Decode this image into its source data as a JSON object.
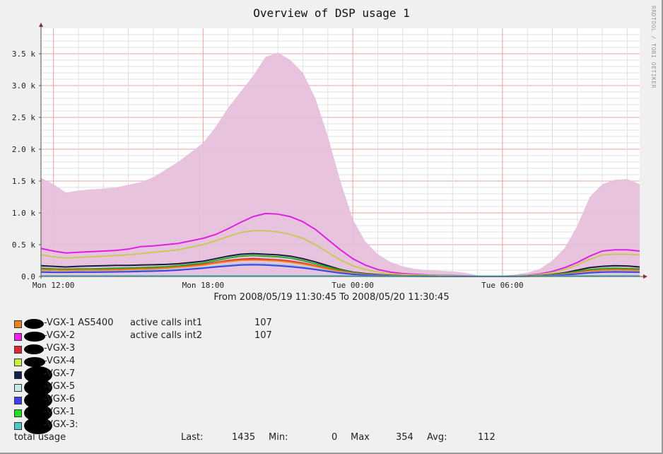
{
  "chart_data": {
    "type": "area",
    "title": "Overview of DSP usage 1",
    "watermark": "RRDTOOL / TOBI OETIKER",
    "xlabel": "",
    "ylabel": "",
    "ylim": [
      0,
      3900
    ],
    "y_ticks": [
      {
        "value": 0,
        "label": "0.0"
      },
      {
        "value": 500,
        "label": "0.5 k"
      },
      {
        "value": 1000,
        "label": "1.0 k"
      },
      {
        "value": 1500,
        "label": "1.5 k"
      },
      {
        "value": 2000,
        "label": "2.0 k"
      },
      {
        "value": 2500,
        "label": "2.5 k"
      },
      {
        "value": 3000,
        "label": "3.0 k"
      },
      {
        "value": 3500,
        "label": "3.5 k"
      }
    ],
    "x_range_hours": [
      11.5,
      35.5
    ],
    "x_ticks": [
      {
        "hour": 12,
        "label": "Mon 12:00"
      },
      {
        "hour": 18,
        "label": "Mon 18:00"
      },
      {
        "hour": 24,
        "label": "Tue 00:00"
      },
      {
        "hour": 30,
        "label": "Tue 06:00"
      }
    ],
    "grid": true,
    "time_range": "From 2008/05/19 11:30:45 To 2008/05/20 11:30:45",
    "x": [
      11.5,
      12,
      12.5,
      13,
      13.5,
      14,
      14.5,
      15,
      15.5,
      16,
      16.5,
      17,
      17.5,
      18,
      18.5,
      19,
      19.5,
      20,
      20.5,
      21,
      21.5,
      22,
      22.5,
      23,
      23.5,
      24,
      24.5,
      25,
      25.5,
      26,
      26.5,
      27,
      27.5,
      28,
      28.5,
      29,
      29.5,
      30,
      30.5,
      31,
      31.5,
      32,
      32.5,
      33,
      33.5,
      34,
      34.5,
      35,
      35.5
    ],
    "series": [
      {
        "name": "total usage",
        "kind": "area",
        "color": "#e6c0dc",
        "values": [
          1550,
          1450,
          1320,
          1350,
          1370,
          1380,
          1400,
          1440,
          1480,
          1560,
          1680,
          1800,
          1950,
          2100,
          2350,
          2650,
          2900,
          3150,
          3450,
          3520,
          3400,
          3200,
          2800,
          2200,
          1500,
          900,
          550,
          350,
          230,
          160,
          120,
          100,
          90,
          80,
          60,
          20,
          10,
          10,
          30,
          60,
          120,
          250,
          450,
          800,
          1250,
          1450,
          1520,
          1530,
          1450
        ]
      },
      {
        "name": "VGX-2",
        "kind": "line",
        "color": "#e020e0",
        "values": [
          440,
          400,
          370,
          380,
          390,
          400,
          410,
          430,
          470,
          480,
          500,
          520,
          560,
          600,
          660,
          750,
          850,
          940,
          990,
          980,
          940,
          860,
          740,
          580,
          420,
          280,
          180,
          110,
          70,
          45,
          35,
          25,
          20,
          15,
          10,
          5,
          5,
          5,
          10,
          20,
          40,
          80,
          140,
          220,
          320,
          400,
          420,
          420,
          400
        ]
      },
      {
        "name": "VGX-4",
        "kind": "line",
        "color": "#c8c858",
        "values": [
          340,
          310,
          290,
          300,
          310,
          320,
          330,
          340,
          360,
          380,
          400,
          420,
          460,
          500,
          560,
          630,
          690,
          720,
          720,
          700,
          660,
          600,
          500,
          380,
          260,
          170,
          110,
          70,
          45,
          30,
          25,
          20,
          15,
          10,
          8,
          5,
          5,
          5,
          10,
          15,
          30,
          60,
          110,
          180,
          270,
          340,
          350,
          350,
          340
        ]
      },
      {
        "name": "VGX-7",
        "kind": "line",
        "color": "#1a1a40",
        "values": [
          170,
          160,
          150,
          160,
          165,
          170,
          175,
          175,
          180,
          185,
          190,
          200,
          220,
          240,
          280,
          320,
          350,
          360,
          350,
          340,
          320,
          280,
          230,
          170,
          110,
          70,
          45,
          30,
          20,
          12,
          10,
          8,
          6,
          5,
          4,
          3,
          3,
          3,
          5,
          8,
          15,
          30,
          60,
          100,
          140,
          160,
          170,
          165,
          150
        ]
      },
      {
        "name": "VGX-1",
        "kind": "line",
        "color": "#22b022",
        "values": [
          130,
          120,
          115,
          120,
          120,
          125,
          130,
          135,
          140,
          145,
          155,
          170,
          190,
          210,
          250,
          290,
          320,
          330,
          320,
          310,
          290,
          250,
          200,
          150,
          100,
          65,
          40,
          25,
          15,
          10,
          8,
          6,
          5,
          4,
          3,
          3,
          3,
          3,
          4,
          6,
          12,
          25,
          50,
          80,
          110,
          125,
          130,
          125,
          120
        ]
      },
      {
        "name": "VGX-3",
        "kind": "line",
        "color": "#e02828",
        "values": [
          110,
          100,
          100,
          105,
          100,
          105,
          110,
          115,
          120,
          125,
          135,
          150,
          170,
          190,
          220,
          250,
          270,
          280,
          270,
          260,
          240,
          210,
          170,
          125,
          85,
          55,
          35,
          22,
          14,
          9,
          7,
          5,
          4,
          3,
          3,
          2,
          2,
          2,
          3,
          5,
          10,
          20,
          40,
          65,
          90,
          100,
          110,
          105,
          100
        ]
      },
      {
        "name": "VGX-1 AS5400",
        "kind": "line",
        "color": "#f08020",
        "values": [
          105,
          100,
          95,
          100,
          100,
          100,
          105,
          110,
          115,
          120,
          130,
          145,
          160,
          180,
          210,
          235,
          255,
          260,
          255,
          245,
          225,
          195,
          160,
          115,
          80,
          50,
          30,
          20,
          12,
          8,
          6,
          5,
          4,
          3,
          3,
          2,
          2,
          2,
          3,
          5,
          10,
          20,
          38,
          60,
          85,
          95,
          105,
          100,
          95
        ]
      },
      {
        "name": "VGX-5",
        "kind": "line",
        "color": "#80c8e0",
        "values": [
          80,
          75,
          70,
          75,
          75,
          78,
          80,
          85,
          90,
          95,
          100,
          110,
          125,
          140,
          160,
          180,
          195,
          200,
          195,
          185,
          170,
          150,
          120,
          90,
          60,
          40,
          25,
          15,
          10,
          6,
          5,
          4,
          3,
          2,
          2,
          2,
          2,
          2,
          2,
          4,
          8,
          15,
          28,
          45,
          65,
          75,
          80,
          78,
          75
        ]
      },
      {
        "name": "VGX-6",
        "kind": "line",
        "color": "#4040e0",
        "values": [
          70,
          65,
          65,
          70,
          68,
          70,
          72,
          75,
          80,
          85,
          90,
          100,
          115,
          130,
          150,
          165,
          180,
          185,
          180,
          170,
          155,
          135,
          110,
          80,
          55,
          35,
          22,
          14,
          9,
          6,
          4,
          3,
          3,
          2,
          2,
          2,
          2,
          2,
          2,
          4,
          7,
          14,
          25,
          40,
          58,
          68,
          72,
          70,
          68
        ]
      },
      {
        "name": "VGX-3:",
        "kind": "line",
        "color": "#40c0c0",
        "values": [
          10,
          10,
          10,
          10,
          10,
          10,
          10,
          10,
          10,
          10,
          10,
          10,
          10,
          10,
          10,
          10,
          10,
          10,
          10,
          10,
          10,
          10,
          10,
          10,
          10,
          8,
          6,
          5,
          4,
          4,
          4,
          4,
          4,
          4,
          4,
          4,
          4,
          4,
          4,
          4,
          5,
          6,
          8,
          10,
          10,
          10,
          10,
          10,
          10
        ]
      }
    ]
  },
  "legend": {
    "items": [
      {
        "label": "-VGX-1 AS5400",
        "color": "#f08020",
        "extra": "active calls int1",
        "value": "107"
      },
      {
        "label": "-VGX-2",
        "color": "#f020f0",
        "extra": "active calls int2",
        "value": "107"
      },
      {
        "label": "-VGX-3",
        "color": "#e02838",
        "extra": "",
        "value": ""
      },
      {
        "label": "-VGX-4",
        "color": "#c8f040",
        "extra": "",
        "value": ""
      },
      {
        "label": "-VGX-7",
        "color": "#102048",
        "extra": "",
        "value": ""
      },
      {
        "label": "-VGX-5",
        "color": "#c0ecec",
        "extra": "",
        "value": ""
      },
      {
        "label": "-VGX-6",
        "color": "#4040f0",
        "extra": "",
        "value": ""
      },
      {
        "label": "-VGX-1",
        "color": "#20e020",
        "extra": "",
        "value": ""
      },
      {
        "label": "-VGX-3:",
        "color": "#50c8c8",
        "extra": "",
        "value": ""
      }
    ]
  },
  "totals": {
    "label": "total usage",
    "last_label": "Last:",
    "last": "1435",
    "min_label": "Min:",
    "min": "0",
    "max_label": "Max",
    "max": "354",
    "avg_label": "Avg:",
    "avg": "112"
  }
}
